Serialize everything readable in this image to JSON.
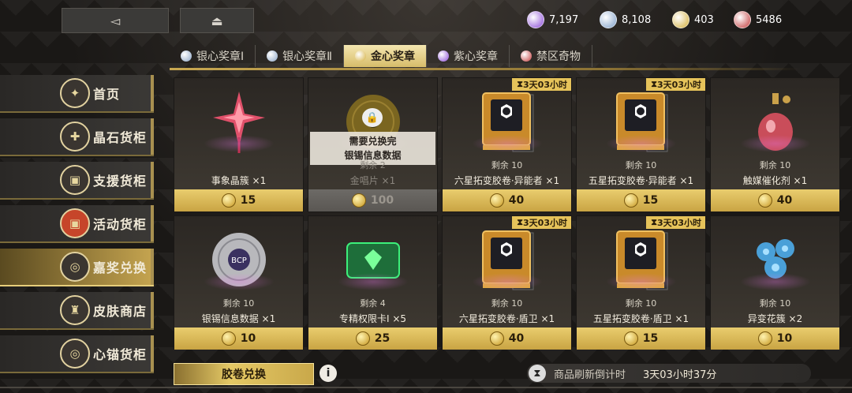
{
  "currencies": [
    {
      "icon": "purple-gem-icon",
      "value": "7,197",
      "color": "#8a4ad6"
    },
    {
      "icon": "blue-gem-icon",
      "value": "8,108",
      "color": "#7fa0c8"
    },
    {
      "icon": "gold-medal-icon",
      "value": "403",
      "color": "#d4ae3a"
    },
    {
      "icon": "red-gem-icon",
      "value": "5486",
      "color": "#c23a3a"
    }
  ],
  "tabs": [
    {
      "label": "银心奖章Ⅰ",
      "color": "#8aa3c4",
      "active": false
    },
    {
      "label": "银心奖章Ⅱ",
      "color": "#8aa3c4",
      "active": false
    },
    {
      "label": "金心奖章",
      "color": "#d4ae3a",
      "active": true
    },
    {
      "label": "紫心奖章",
      "color": "#8a4ad6",
      "active": false
    },
    {
      "label": "禁区奇物",
      "color": "#c23a3a",
      "active": false
    }
  ],
  "sidebar": [
    {
      "label": "首页",
      "icon": "home-icon",
      "glyph": "✦"
    },
    {
      "label": "晶石货柜",
      "icon": "crystal-icon",
      "glyph": "✚"
    },
    {
      "label": "支援货柜",
      "icon": "support-crate-icon",
      "glyph": "▣"
    },
    {
      "label": "活动货柜",
      "icon": "event-crate-icon",
      "glyph": "▣"
    },
    {
      "label": "嘉奖兑换",
      "icon": "award-exchange-icon",
      "glyph": "◎"
    },
    {
      "label": "皮肤商店",
      "icon": "skin-shop-icon",
      "glyph": "♜"
    },
    {
      "label": "心锚货柜",
      "icon": "anchor-icon",
      "glyph": "◎"
    }
  ],
  "items": [
    {
      "name": "事象晶簇 ×1",
      "remain": "",
      "price": "15",
      "countdown": "",
      "icon": "crystal-cluster-icon"
    },
    {
      "name": "金唱片 ×1",
      "remain": "剩余 2",
      "price": "100",
      "countdown": "",
      "icon": "gold-record-icon",
      "locked": true,
      "lock_text_1": "需要兑换完",
      "lock_text_2": "银锡信息数据"
    },
    {
      "name": "六星拓变胶卷·异能者 ×1",
      "remain": "剩余 10",
      "price": "40",
      "countdown": "3天03小时",
      "icon": "film-canister-icon"
    },
    {
      "name": "五星拓变胶卷·异能者 ×1",
      "remain": "剩余 10",
      "price": "15",
      "countdown": "3天03小时",
      "icon": "film-canister-icon"
    },
    {
      "name": "触媒催化剂 ×1",
      "remain": "剩余 10",
      "price": "40",
      "countdown": "",
      "icon": "perfume-bottle-icon"
    },
    {
      "name": "银锡信息数据 ×1",
      "remain": "剩余 10",
      "price": "10",
      "countdown": "",
      "icon": "silver-record-icon"
    },
    {
      "name": "专精权限卡Ⅰ ×5",
      "remain": "剩余 4",
      "price": "25",
      "countdown": "",
      "icon": "access-card-icon"
    },
    {
      "name": "六星拓变胶卷·盾卫 ×1",
      "remain": "剩余 10",
      "price": "40",
      "countdown": "3天03小时",
      "icon": "film-canister-icon"
    },
    {
      "name": "五星拓变胶卷·盾卫 ×1",
      "remain": "剩余 10",
      "price": "15",
      "countdown": "3天03小时",
      "icon": "film-canister-icon"
    },
    {
      "name": "异变花簇 ×2",
      "remain": "剩余 10",
      "price": "10",
      "countdown": "",
      "icon": "flower-cluster-icon"
    }
  ],
  "bottom": {
    "capsule_label": "胶卷兑换",
    "info_label": "i",
    "refresh_label": "商品刷新倒计时",
    "refresh_time": "3天03小时37分"
  },
  "nav": {
    "back_glyph": "◅",
    "home_glyph": "⏏"
  }
}
